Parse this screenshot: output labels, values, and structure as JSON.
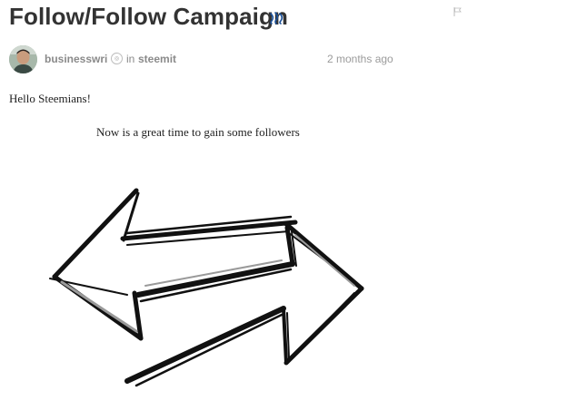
{
  "post": {
    "title": "Follow/Follow Campaign",
    "flag_icon": "flag-icon",
    "title_icon": "steem-logo-icon"
  },
  "byline": {
    "author": "businesswri",
    "reputation_icon": "reputation-badge-icon",
    "in_label": "in",
    "community": "steemit",
    "timestamp": "2 months ago"
  },
  "body": {
    "greeting": "Hello Steemians!",
    "subline": "Now is a great time to gain some followers",
    "image_description_icon": "double-arrow-sketch-image"
  },
  "colors": {
    "title": "#333333",
    "meta": "#8a8a8a",
    "steem_blue": "#1a5099"
  }
}
